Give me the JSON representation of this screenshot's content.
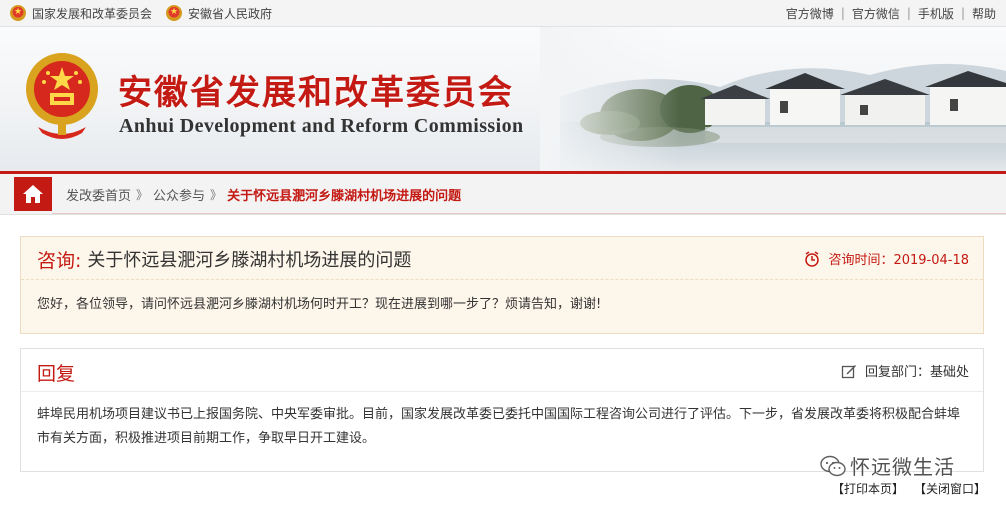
{
  "topbar": {
    "left_links": [
      "国家发展和改革委员会",
      "安徽省人民政府"
    ],
    "right_links": [
      "官方微博",
      "官方微信",
      "手机版",
      "帮助"
    ],
    "separator": "|"
  },
  "banner": {
    "title": "安徽省发展和改革委员会",
    "subtitle": "Anhui Development and Reform Commission"
  },
  "breadcrumb": {
    "items": [
      "发改委首页",
      "公众参与"
    ],
    "current": "关于怀远县淝河乡滕湖村机场进展的问题",
    "arrow": "》"
  },
  "consult": {
    "label": "咨询:",
    "title": "关于怀远县淝河乡滕湖村机场进展的问题",
    "time_label": "咨询时间：2019-04-18",
    "content": "您好，各位领导，请问怀远县淝河乡滕湖村机场何时开工？现在进展到哪一步了？烦请告知，谢谢!"
  },
  "reply": {
    "label": "回复",
    "dept_label": "回复部门：基础处",
    "content": "蚌埠民用机场项目建议书已上报国务院、中央军委审批。目前，国家发展改革委已委托中国国际工程咨询公司进行了评估。下一步，省发展改革委将积极配合蚌埠市有关方面，积极推进项目前期工作，争取早日开工建设。"
  },
  "footer": {
    "print_label": "【打印本页】",
    "close_label": "【关闭窗口】"
  },
  "watermark": {
    "text": "怀远微生活"
  },
  "colors": {
    "accent": "#c41a14",
    "consult_bg": "#fdf6ea",
    "bar_bg": "#f3f3f3"
  },
  "icons": [
    "national-emblem-icon",
    "home-icon",
    "clock-icon",
    "edit-icon",
    "wechat-icon"
  ]
}
